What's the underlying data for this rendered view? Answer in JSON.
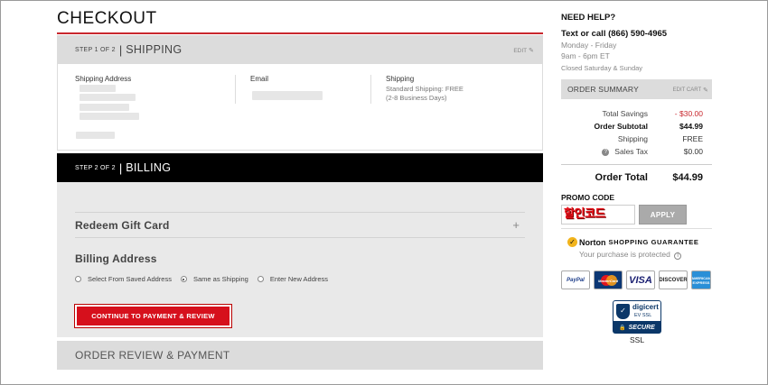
{
  "checkout_title": "CHECKOUT",
  "shipping_step": {
    "step_no": "STEP 1 OF 2",
    "label": "SHIPPING",
    "edit": "EDIT",
    "address_header": "Shipping Address",
    "email_header": "Email",
    "shipping_header": "Shipping",
    "shipping_method": "Standard Shipping: FREE",
    "shipping_time": "(2-8 Business Days)"
  },
  "billing_step": {
    "step_no": "STEP 2 OF 2",
    "label": "BILLING",
    "gift_card": "Redeem Gift Card",
    "billing_address": "Billing Address",
    "options": [
      "Select From Saved Address",
      "Same as Shipping",
      "Enter New Address"
    ],
    "selected_option": "Same as Shipping",
    "continue_button": "CONTINUE TO PAYMENT & REVIEW"
  },
  "review_step": {
    "label": "ORDER REVIEW & PAYMENT"
  },
  "help": {
    "heading": "NEED HELP?",
    "call": "Text or call (866) 590-4965",
    "days": "Monday - Friday",
    "time": "9am - 6pm ET",
    "closed": "Closed Saturday & Sunday"
  },
  "summary": {
    "title": "ORDER SUMMARY",
    "edit_cart": "EDIT CART",
    "total_savings_label": "Total Savings",
    "total_savings": "- $30.00",
    "subtotal_label": "Order Subtotal",
    "subtotal": "$44.99",
    "shipping_label": "Shipping",
    "shipping": "FREE",
    "tax_label": "Sales Tax",
    "tax": "$0.00",
    "total_label": "Order Total",
    "total": "$44.99"
  },
  "promo": {
    "heading": "PROMO CODE",
    "value": "할인코드",
    "apply": "APPLY"
  },
  "norton": {
    "brand": "Norton",
    "tag": "SHOPPING GUARANTEE",
    "protected": "Your purchase is protected"
  },
  "cards": [
    "PayPal",
    "MasterCard",
    "VISA",
    "DISCOVER",
    "AMERICAN EXPRESS"
  ],
  "digicert": {
    "name": "digicert",
    "ev": "EV SSL",
    "secure": "SECURE",
    "ssl": "SSL"
  }
}
